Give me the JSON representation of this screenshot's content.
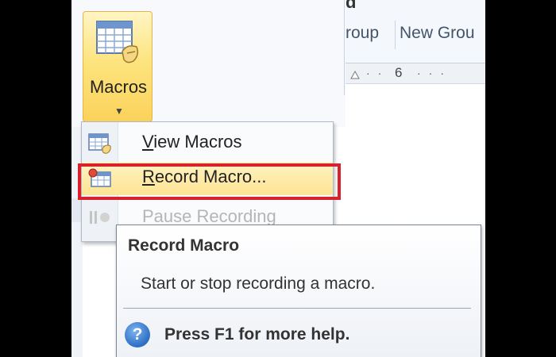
{
  "ribbon": {
    "top_fragment": "d",
    "groups": [
      {
        "label": "roup"
      },
      {
        "label": "New Grou"
      }
    ],
    "ruler_number": "6"
  },
  "macros_button": {
    "label": "Macros",
    "icon": "macro-sheet-icon"
  },
  "menu": {
    "items": [
      {
        "mnemonic": "V",
        "rest": "iew Macros",
        "icon": "view-macros-icon",
        "state": "normal"
      },
      {
        "mnemonic": "R",
        "rest": "ecord Macro...",
        "icon": "record-macro-icon",
        "state": "hover"
      },
      {
        "mnemonic": "",
        "rest": "Pause Recording",
        "icon": "pause-icon",
        "state": "disabled"
      }
    ]
  },
  "tooltip": {
    "title": "Record Macro",
    "description": "Start or stop recording a macro.",
    "help_icon": "help-icon",
    "help_text": "Press F1 for more help."
  },
  "colors": {
    "highlight_border": "#d9212e",
    "hover_fill": "#fde493",
    "button_fill": "#fbd25a"
  }
}
